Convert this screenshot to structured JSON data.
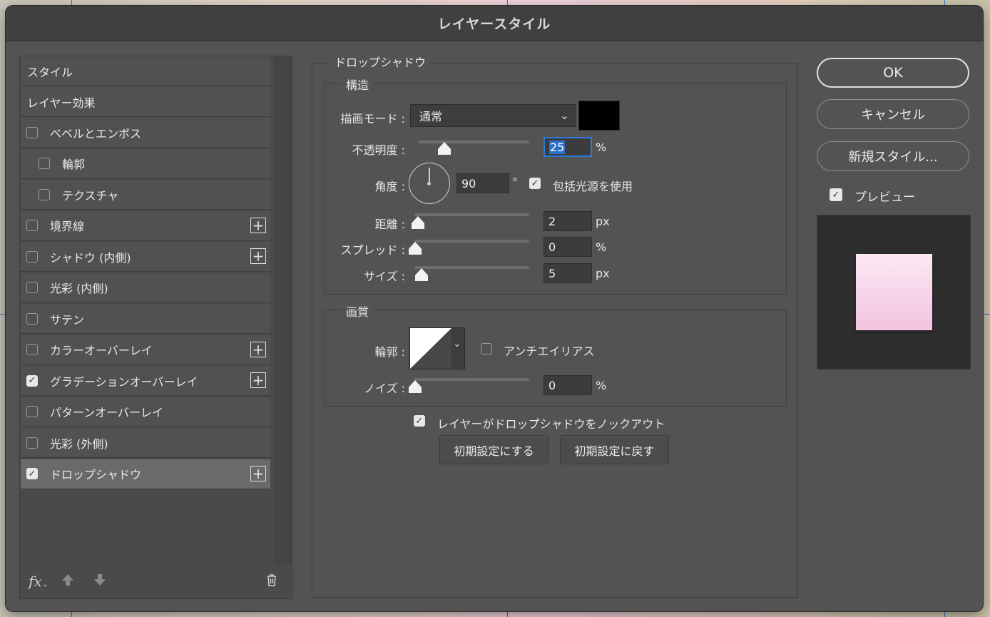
{
  "window": {
    "title": "レイヤースタイル"
  },
  "styles_panel": {
    "header_styles": "スタイル",
    "header_effects": "レイヤー効果",
    "items": [
      {
        "label": "ベベルとエンボス",
        "checked": false,
        "indent": false,
        "plus": false
      },
      {
        "label": "輪郭",
        "checked": false,
        "indent": true,
        "plus": false
      },
      {
        "label": "テクスチャ",
        "checked": false,
        "indent": true,
        "plus": false
      },
      {
        "label": "境界線",
        "checked": false,
        "indent": false,
        "plus": true
      },
      {
        "label": "シャドウ (内側)",
        "checked": false,
        "indent": false,
        "plus": true
      },
      {
        "label": "光彩 (内側)",
        "checked": false,
        "indent": false,
        "plus": false
      },
      {
        "label": "サテン",
        "checked": false,
        "indent": false,
        "plus": false
      },
      {
        "label": "カラーオーバーレイ",
        "checked": false,
        "indent": false,
        "plus": true
      },
      {
        "label": "グラデーションオーバーレイ",
        "checked": true,
        "indent": false,
        "plus": true
      },
      {
        "label": "パターンオーバーレイ",
        "checked": false,
        "indent": false,
        "plus": false
      },
      {
        "label": "光彩 (外側)",
        "checked": false,
        "indent": false,
        "plus": false
      },
      {
        "label": "ドロップシャドウ",
        "checked": true,
        "indent": false,
        "plus": true,
        "selected": true
      }
    ],
    "fx_label": "fx",
    "icons": {
      "up": "arrow-up-icon",
      "down": "arrow-down-icon",
      "trash": "trash-icon"
    }
  },
  "drop_shadow": {
    "section_title": "ドロップシャドウ",
    "structure": {
      "title": "構造",
      "blend_mode_label": "描画モード :",
      "blend_mode_value": "通常",
      "shadow_color": "#000000",
      "opacity_label": "不透明度 :",
      "opacity_value": "25",
      "opacity_unit": "%",
      "angle_label": "角度 :",
      "angle_value": "90",
      "angle_unit": "°",
      "global_light_label": "包括光源を使用",
      "global_light_checked": true,
      "distance_label": "距離 :",
      "distance_value": "2",
      "distance_unit": "px",
      "spread_label": "スプレッド :",
      "spread_value": "0",
      "spread_unit": "%",
      "size_label": "サイズ :",
      "size_value": "5",
      "size_unit": "px"
    },
    "quality": {
      "title": "画質",
      "contour_label": "輪郭 :",
      "antialias_label": "アンチエイリアス",
      "antialias_checked": false,
      "noise_label": "ノイズ :",
      "noise_value": "0",
      "noise_unit": "%"
    },
    "knockout_label": "レイヤーがドロップシャドウをノックアウト",
    "knockout_checked": true,
    "make_default_label": "初期設定にする",
    "reset_default_label": "初期設定に戻す"
  },
  "right_panel": {
    "ok_label": "OK",
    "cancel_label": "キャンセル",
    "new_style_label": "新規スタイル...",
    "preview_label": "プレビュー",
    "preview_checked": true,
    "preview_colors": {
      "top": "#fbe9f4",
      "bottom": "#f3c2df",
      "background": "#2e2e2e"
    }
  }
}
